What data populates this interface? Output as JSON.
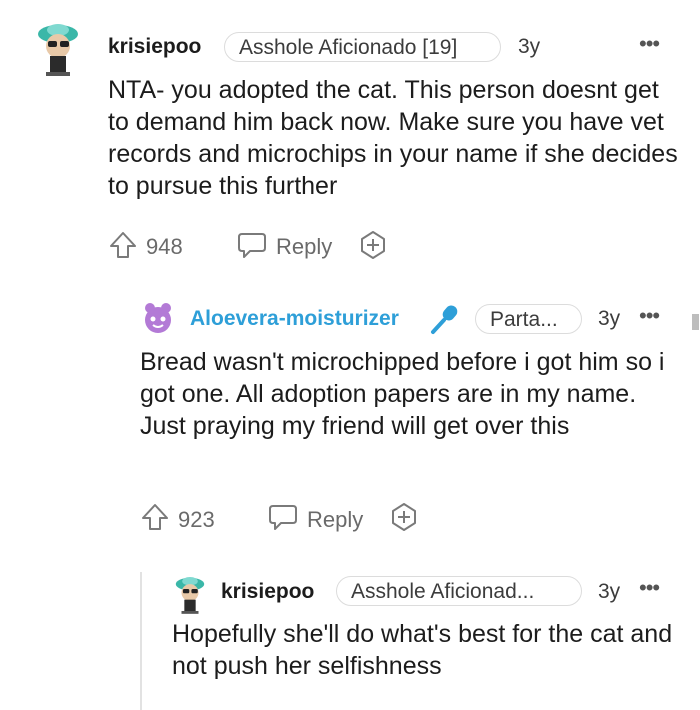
{
  "comments": [
    {
      "username": "krisiepoo",
      "flair": "Asshole Aficionado [19]",
      "time": "3y",
      "body": "NTA- you adopted the cat. This person doesnt get to demand him back now. Make sure you have vet records and microchips in your name if she decides to pursue this further",
      "votes": "948",
      "reply_label": "Reply"
    },
    {
      "username": "Aloevera-moisturizer",
      "flair": "Parta...",
      "time": "3y",
      "body": "Bread wasn't microchipped before i got him so i got one. All adoption papers are in my name. Just praying my friend will get over this",
      "votes": "923",
      "reply_label": "Reply",
      "username_color": "#2e9fd8"
    },
    {
      "username": "krisiepoo",
      "flair": "Asshole Aficionad...",
      "time": "3y",
      "body": "Hopefully she'll do what's best for the cat and not push her selfishness"
    }
  ],
  "more_label": "•••"
}
